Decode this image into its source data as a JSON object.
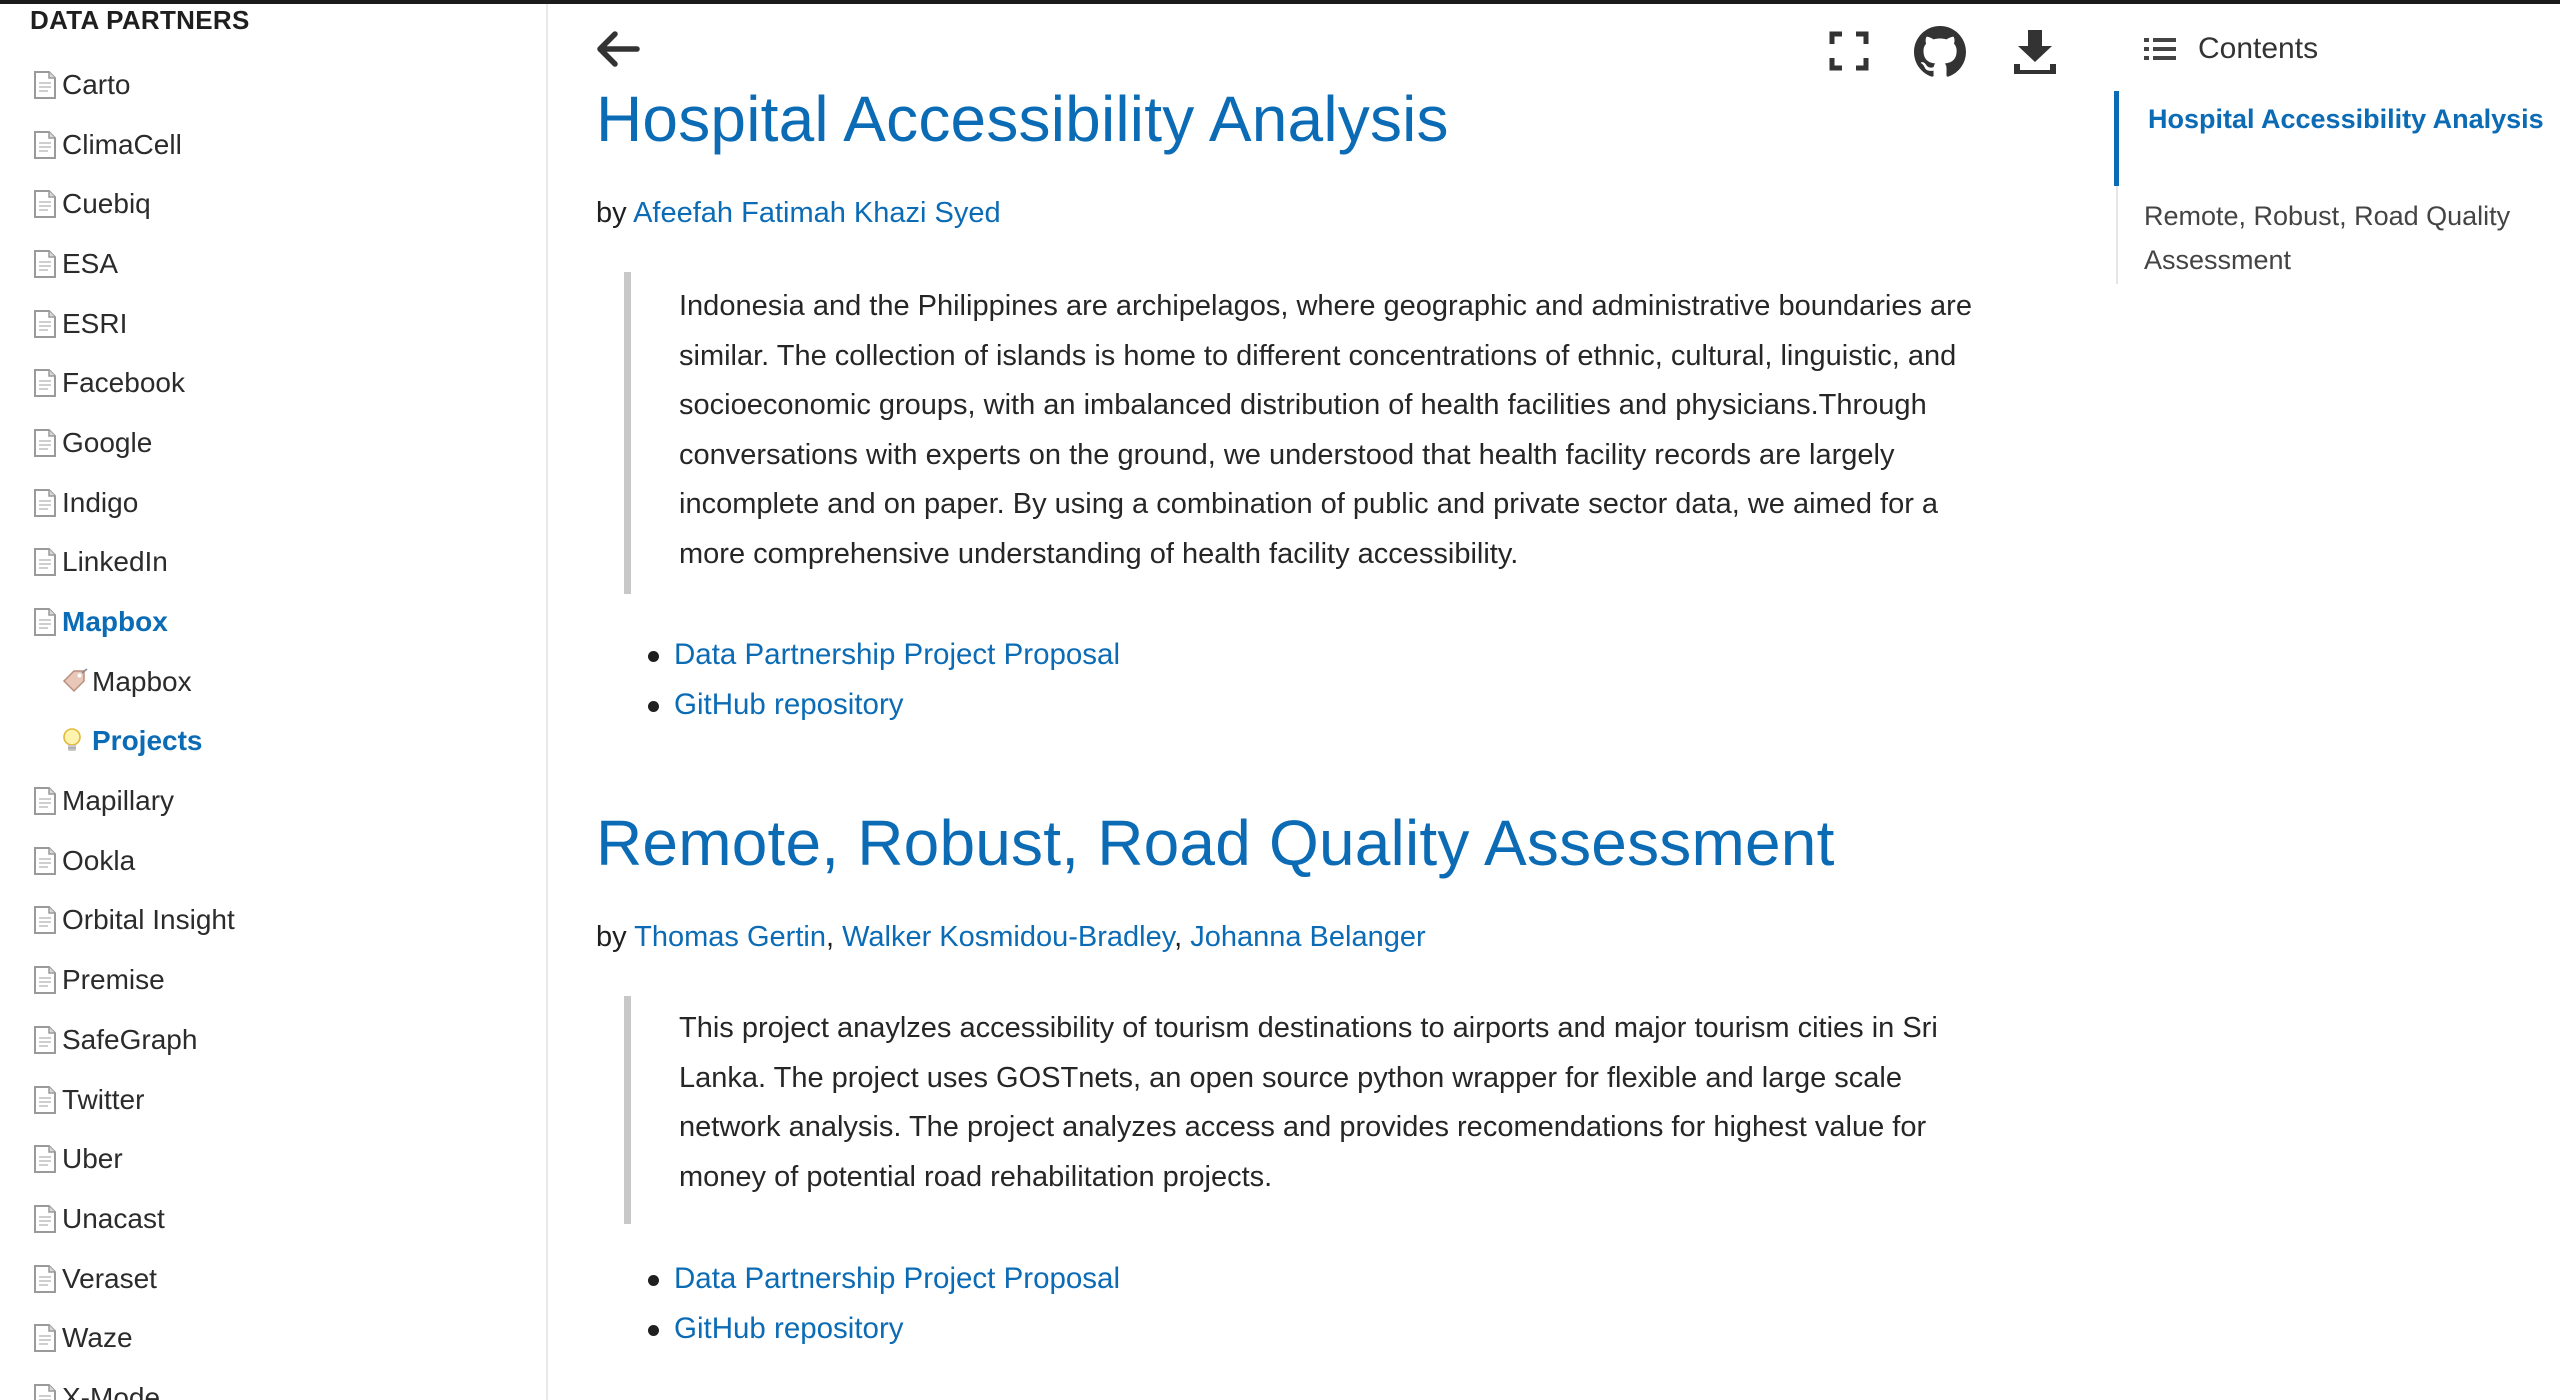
{
  "sidebar": {
    "caption": "DATA PARTNERS",
    "items": [
      {
        "label": "Carto",
        "type": "doc"
      },
      {
        "label": "ClimaCell",
        "type": "doc"
      },
      {
        "label": "Cuebiq",
        "type": "doc"
      },
      {
        "label": "ESA",
        "type": "doc"
      },
      {
        "label": "ESRI",
        "type": "doc"
      },
      {
        "label": "Facebook",
        "type": "doc"
      },
      {
        "label": "Google",
        "type": "doc"
      },
      {
        "label": "Indigo",
        "type": "doc"
      },
      {
        "label": "LinkedIn",
        "type": "doc"
      },
      {
        "label": "Mapbox",
        "type": "doc",
        "active": true
      },
      {
        "label": "Mapbox",
        "type": "tag",
        "sub": true
      },
      {
        "label": "Projects",
        "type": "bulb",
        "sub": true,
        "active": true
      },
      {
        "label": "Mapillary",
        "type": "doc"
      },
      {
        "label": "Ookla",
        "type": "doc"
      },
      {
        "label": "Orbital Insight",
        "type": "doc"
      },
      {
        "label": "Premise",
        "type": "doc"
      },
      {
        "label": "SafeGraph",
        "type": "doc"
      },
      {
        "label": "Twitter",
        "type": "doc"
      },
      {
        "label": "Uber",
        "type": "doc"
      },
      {
        "label": "Unacast",
        "type": "doc"
      },
      {
        "label": "Veraset",
        "type": "doc"
      },
      {
        "label": "Waze",
        "type": "doc"
      },
      {
        "label": "X-Mode",
        "type": "doc"
      }
    ]
  },
  "icons": {
    "back": "arrow-left-icon",
    "fullscreen": "fullscreen-icon",
    "github": "github-icon",
    "download": "download-icon",
    "contents": "list-icon"
  },
  "colors": {
    "accent": "#0b6bb5",
    "quote_border": "#c8c8c8"
  },
  "projects": [
    {
      "title": "Hospital Accessibility Analysis",
      "by": "by ",
      "authors": [
        "Afeefah Fatimah Khazi Syed"
      ],
      "summary": "Indonesia and the Philippines are archipelagos, where geographic and administrative boundaries are similar. The collection of islands is home to different concentrations of ethnic, cultural, linguistic, and socioeconomic groups, with an imbalanced distribution of health facilities and physicians.Through conversations with experts on the ground, we understood that health facility records are largely incomplete and on paper. By using a combination of public and private sector data, we aimed for a more comprehensive understanding of health facility accessibility.",
      "links": [
        "Data Partnership Project Proposal",
        "GitHub repository"
      ]
    },
    {
      "title": "Remote, Robust, Road Quality Assessment",
      "by": "by ",
      "authors": [
        "Thomas Gertin",
        "Walker Kosmidou-Bradley",
        "Johanna Belanger"
      ],
      "separator": ", ",
      "summary": "This project anaylzes accessibility of tourism destinations to airports and major tourism cities in Sri Lanka. The project uses GOSTnets, an open source python wrapper for flexible and large scale network analysis. The project analyzes access and provides recomendations for highest value for money of potential road rehabilitation projects.",
      "links": [
        "Data Partnership Project Proposal",
        "GitHub repository"
      ]
    }
  ],
  "toc": {
    "heading": "Contents",
    "items": [
      {
        "label": "Hospital Accessibility Analysis",
        "active": true
      },
      {
        "label": "Remote, Robust, Road Quality Assessment",
        "active": false
      }
    ]
  }
}
